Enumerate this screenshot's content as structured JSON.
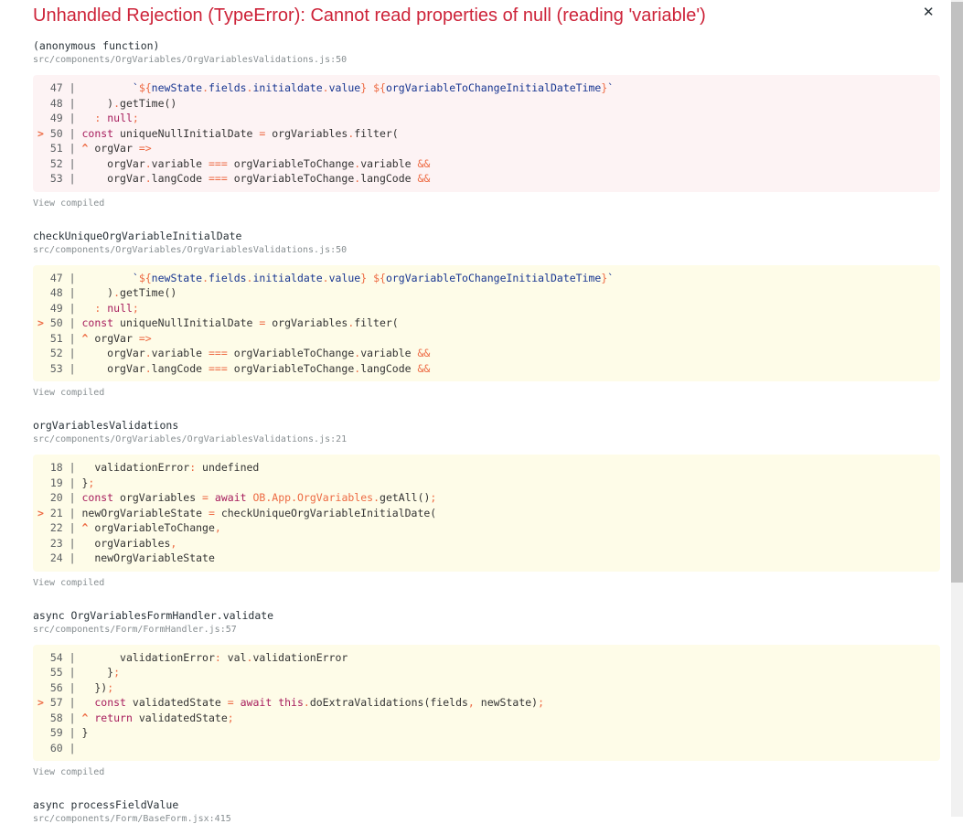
{
  "overlay": {
    "title": "Unhandled Rejection (TypeError): Cannot read properties of null (reading 'variable')",
    "close_icon": "✕",
    "view_compiled_label": "View compiled"
  },
  "colors": {
    "title": "#cd2339",
    "frame_bg_error": "rgba(206, 17, 38, 0.05)",
    "frame_bg": "rgba(251, 245, 180, 0.3)",
    "keyword": "#a71d5d",
    "punctuation": "#ed6a43",
    "string": "#183691",
    "capitalized": "#ed6a43",
    "text": "#333333",
    "gutter": "#5c6063",
    "muted": "#878e91"
  },
  "frames": [
    {
      "name": "(anonymous function)",
      "location": "src/components/OrgVariables/OrgVariablesValidations.js:50",
      "variant": "error",
      "code": {
        "lines": [
          {
            "n": "47",
            "marker": false,
            "tokens": [
              [
                "t",
                "        "
              ],
              [
                "s",
                "`"
              ],
              [
                "p",
                "${"
              ],
              [
                "s",
                "newState"
              ],
              [
                "p",
                "."
              ],
              [
                "s",
                "fields"
              ],
              [
                "p",
                "."
              ],
              [
                "s",
                "initialdate"
              ],
              [
                "p",
                "."
              ],
              [
                "s",
                "value"
              ],
              [
                "p",
                "}"
              ],
              [
                "s",
                " "
              ],
              [
                "p",
                "${"
              ],
              [
                "s",
                "orgVariableToChangeInitialDateTime"
              ],
              [
                "p",
                "}"
              ],
              [
                "s",
                "`"
              ]
            ]
          },
          {
            "n": "48",
            "marker": false,
            "tokens": [
              [
                "t",
                "    )"
              ],
              [
                "p",
                "."
              ],
              [
                "t",
                "getTime()"
              ]
            ]
          },
          {
            "n": "49",
            "marker": false,
            "tokens": [
              [
                "t",
                "  "
              ],
              [
                "p",
                ":"
              ],
              [
                "t",
                " "
              ],
              [
                "k",
                "null"
              ],
              [
                "p",
                ";"
              ]
            ]
          },
          {
            "n": "50",
            "marker": true,
            "tokens": [
              [
                "k",
                "const"
              ],
              [
                "t",
                " uniqueNullInitialDate "
              ],
              [
                "p",
                "="
              ],
              [
                "t",
                " orgVariables"
              ],
              [
                "p",
                "."
              ],
              [
                "t",
                "filter("
              ]
            ]
          },
          {
            "n": "51",
            "marker": false,
            "tokens": [
              [
                "m",
                "^"
              ],
              [
                "t",
                " orgVar "
              ],
              [
                "p",
                "=>"
              ]
            ]
          },
          {
            "n": "52",
            "marker": false,
            "tokens": [
              [
                "t",
                "    orgVar"
              ],
              [
                "p",
                "."
              ],
              [
                "t",
                "variable "
              ],
              [
                "p",
                "==="
              ],
              [
                "t",
                " orgVariableToChange"
              ],
              [
                "p",
                "."
              ],
              [
                "t",
                "variable "
              ],
              [
                "p",
                "&&"
              ]
            ]
          },
          {
            "n": "53",
            "marker": false,
            "tokens": [
              [
                "t",
                "    orgVar"
              ],
              [
                "p",
                "."
              ],
              [
                "t",
                "langCode "
              ],
              [
                "p",
                "==="
              ],
              [
                "t",
                " orgVariableToChange"
              ],
              [
                "p",
                "."
              ],
              [
                "t",
                "langCode "
              ],
              [
                "p",
                "&&"
              ]
            ]
          }
        ]
      }
    },
    {
      "name": "checkUniqueOrgVariableInitialDate",
      "location": "src/components/OrgVariables/OrgVariablesValidations.js:50",
      "variant": "normal",
      "code": {
        "lines": [
          {
            "n": "47",
            "marker": false,
            "tokens": [
              [
                "t",
                "        "
              ],
              [
                "s",
                "`"
              ],
              [
                "p",
                "${"
              ],
              [
                "s",
                "newState"
              ],
              [
                "p",
                "."
              ],
              [
                "s",
                "fields"
              ],
              [
                "p",
                "."
              ],
              [
                "s",
                "initialdate"
              ],
              [
                "p",
                "."
              ],
              [
                "s",
                "value"
              ],
              [
                "p",
                "}"
              ],
              [
                "s",
                " "
              ],
              [
                "p",
                "${"
              ],
              [
                "s",
                "orgVariableToChangeInitialDateTime"
              ],
              [
                "p",
                "}"
              ],
              [
                "s",
                "`"
              ]
            ]
          },
          {
            "n": "48",
            "marker": false,
            "tokens": [
              [
                "t",
                "    )"
              ],
              [
                "p",
                "."
              ],
              [
                "t",
                "getTime()"
              ]
            ]
          },
          {
            "n": "49",
            "marker": false,
            "tokens": [
              [
                "t",
                "  "
              ],
              [
                "p",
                ":"
              ],
              [
                "t",
                " "
              ],
              [
                "k",
                "null"
              ],
              [
                "p",
                ";"
              ]
            ]
          },
          {
            "n": "50",
            "marker": true,
            "tokens": [
              [
                "k",
                "const"
              ],
              [
                "t",
                " uniqueNullInitialDate "
              ],
              [
                "p",
                "="
              ],
              [
                "t",
                " orgVariables"
              ],
              [
                "p",
                "."
              ],
              [
                "t",
                "filter("
              ]
            ]
          },
          {
            "n": "51",
            "marker": false,
            "tokens": [
              [
                "m",
                "^"
              ],
              [
                "t",
                " orgVar "
              ],
              [
                "p",
                "=>"
              ]
            ]
          },
          {
            "n": "52",
            "marker": false,
            "tokens": [
              [
                "t",
                "    orgVar"
              ],
              [
                "p",
                "."
              ],
              [
                "t",
                "variable "
              ],
              [
                "p",
                "==="
              ],
              [
                "t",
                " orgVariableToChange"
              ],
              [
                "p",
                "."
              ],
              [
                "t",
                "variable "
              ],
              [
                "p",
                "&&"
              ]
            ]
          },
          {
            "n": "53",
            "marker": false,
            "tokens": [
              [
                "t",
                "    orgVar"
              ],
              [
                "p",
                "."
              ],
              [
                "t",
                "langCode "
              ],
              [
                "p",
                "==="
              ],
              [
                "t",
                " orgVariableToChange"
              ],
              [
                "p",
                "."
              ],
              [
                "t",
                "langCode "
              ],
              [
                "p",
                "&&"
              ]
            ]
          }
        ]
      }
    },
    {
      "name": "orgVariablesValidations",
      "location": "src/components/OrgVariables/OrgVariablesValidations.js:21",
      "variant": "normal",
      "code": {
        "lines": [
          {
            "n": "18",
            "marker": false,
            "tokens": [
              [
                "t",
                "  validationError"
              ],
              [
                "p",
                ":"
              ],
              [
                "t",
                " undefined"
              ]
            ]
          },
          {
            "n": "19",
            "marker": false,
            "tokens": [
              [
                "t",
                "}"
              ],
              [
                "p",
                ";"
              ]
            ]
          },
          {
            "n": "20",
            "marker": false,
            "tokens": [
              [
                "k",
                "const"
              ],
              [
                "t",
                " orgVariables "
              ],
              [
                "p",
                "="
              ],
              [
                "t",
                " "
              ],
              [
                "k",
                "await"
              ],
              [
                "t",
                " "
              ],
              [
                "c",
                "OB"
              ],
              [
                "p",
                "."
              ],
              [
                "c",
                "App"
              ],
              [
                "p",
                "."
              ],
              [
                "c",
                "OrgVariables"
              ],
              [
                "p",
                "."
              ],
              [
                "t",
                "getAll()"
              ],
              [
                "p",
                ";"
              ]
            ]
          },
          {
            "n": "21",
            "marker": true,
            "tokens": [
              [
                "t",
                "newOrgVariableState "
              ],
              [
                "p",
                "="
              ],
              [
                "t",
                " checkUniqueOrgVariableInitialDate("
              ]
            ]
          },
          {
            "n": "22",
            "marker": false,
            "tokens": [
              [
                "m",
                "^"
              ],
              [
                "t",
                " orgVariableToChange"
              ],
              [
                "p",
                ","
              ]
            ]
          },
          {
            "n": "23",
            "marker": false,
            "tokens": [
              [
                "t",
                "  orgVariables"
              ],
              [
                "p",
                ","
              ]
            ]
          },
          {
            "n": "24",
            "marker": false,
            "tokens": [
              [
                "t",
                "  newOrgVariableState"
              ]
            ]
          }
        ]
      }
    },
    {
      "name": "async OrgVariablesFormHandler.validate",
      "location": "src/components/Form/FormHandler.js:57",
      "variant": "normal",
      "code": {
        "lines": [
          {
            "n": "54",
            "marker": false,
            "tokens": [
              [
                "t",
                "      validationError"
              ],
              [
                "p",
                ":"
              ],
              [
                "t",
                " val"
              ],
              [
                "p",
                "."
              ],
              [
                "t",
                "validationError"
              ]
            ]
          },
          {
            "n": "55",
            "marker": false,
            "tokens": [
              [
                "t",
                "    }"
              ],
              [
                "p",
                ";"
              ]
            ]
          },
          {
            "n": "56",
            "marker": false,
            "tokens": [
              [
                "t",
                "  })"
              ],
              [
                "p",
                ";"
              ]
            ]
          },
          {
            "n": "57",
            "marker": true,
            "tokens": [
              [
                "t",
                "  "
              ],
              [
                "k",
                "const"
              ],
              [
                "t",
                " validatedState "
              ],
              [
                "p",
                "="
              ],
              [
                "t",
                " "
              ],
              [
                "k",
                "await"
              ],
              [
                "t",
                " "
              ],
              [
                "k",
                "this"
              ],
              [
                "p",
                "."
              ],
              [
                "t",
                "doExtraValidations(fields"
              ],
              [
                "p",
                ","
              ],
              [
                "t",
                " newState)"
              ],
              [
                "p",
                ";"
              ]
            ]
          },
          {
            "n": "58",
            "marker": false,
            "tokens": [
              [
                "m",
                "^"
              ],
              [
                "t",
                " "
              ],
              [
                "k",
                "return"
              ],
              [
                "t",
                " validatedState"
              ],
              [
                "p",
                ";"
              ]
            ]
          },
          {
            "n": "59",
            "marker": false,
            "tokens": [
              [
                "t",
                "}"
              ]
            ]
          },
          {
            "n": "60",
            "marker": false,
            "tokens": []
          }
        ]
      }
    },
    {
      "name": "async processFieldValue",
      "location": "src/components/Form/BaseForm.jsx:415",
      "variant": "normal"
    }
  ]
}
